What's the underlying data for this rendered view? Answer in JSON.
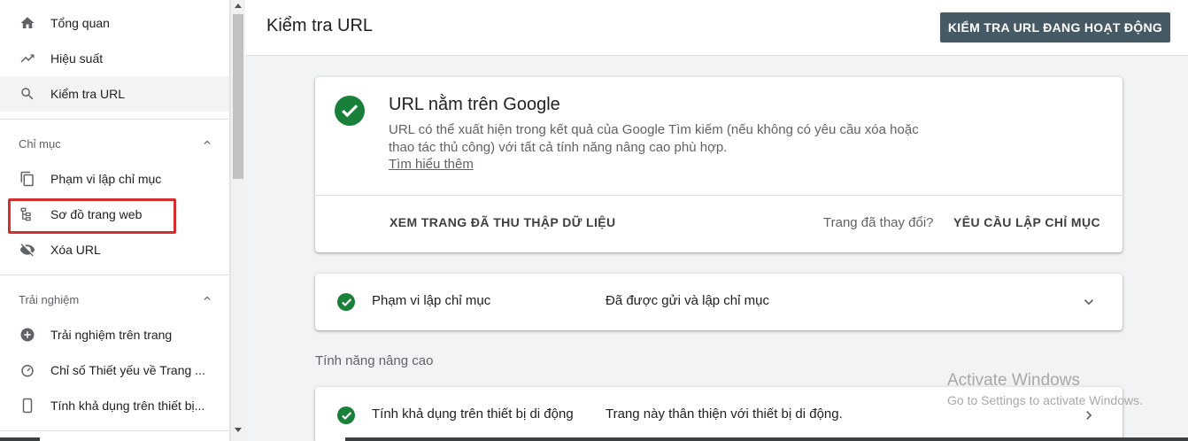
{
  "sidebar": {
    "items_top": [
      {
        "label": "Tổng quan",
        "icon": "home-icon"
      },
      {
        "label": "Hiệu suất",
        "icon": "trending-up-icon"
      },
      {
        "label": "Kiểm tra URL",
        "icon": "search-icon"
      }
    ],
    "index_section": {
      "title": "Chỉ mục",
      "items": [
        {
          "label": "Phạm vi lập chỉ mục",
          "icon": "copy-icon"
        },
        {
          "label": "Sơ đồ trang web",
          "icon": "sitemap-icon"
        },
        {
          "label": "Xóa URL",
          "icon": "visibility-off-icon"
        }
      ]
    },
    "experience_section": {
      "title": "Trải nghiệm",
      "items": [
        {
          "label": "Trải nghiệm trên trang",
          "icon": "add-circle-icon"
        },
        {
          "label": "Chỉ số Thiết yếu về Trang ...",
          "icon": "speed-icon"
        },
        {
          "label": "Tính khả dụng trên thiết bị...",
          "icon": "smartphone-icon"
        }
      ]
    }
  },
  "header": {
    "title": "Kiểm tra URL",
    "live_test_button": "KIỂM TRA URL ĐANG HOẠT ĐỘNG"
  },
  "result_card": {
    "title": "URL nằm trên Google",
    "description": "URL có thể xuất hiện trong kết quả của Google Tìm kiếm (nếu không có yêu cầu xóa hoặc thao tác thủ công) với tất cả tính năng nâng cao phù hợp.",
    "learn_more": "Tìm hiểu thêm",
    "view_crawled_button": "XEM TRANG ĐÃ THU THẬP DỮ LIỆU",
    "page_changed_text": "Trang đã thay đổi?",
    "request_indexing_button": "YÊU CẦU LẬP CHỈ MỤC"
  },
  "coverage_row": {
    "label": "Phạm vi lập chỉ mục",
    "value": "Đã được gửi và lập chỉ mục"
  },
  "enhancements": {
    "title": "Tính năng nâng cao",
    "mobile_row": {
      "label": "Tính khả dụng trên thiết bị di động",
      "value": "Trang này thân thiện với thiết bị di động."
    }
  },
  "watermark": {
    "line1": "Activate Windows",
    "line2": "Go to Settings to activate Windows."
  },
  "colors": {
    "success_green": "#188038",
    "button_dark": "#455a64",
    "highlight_red": "#d32f2f"
  }
}
